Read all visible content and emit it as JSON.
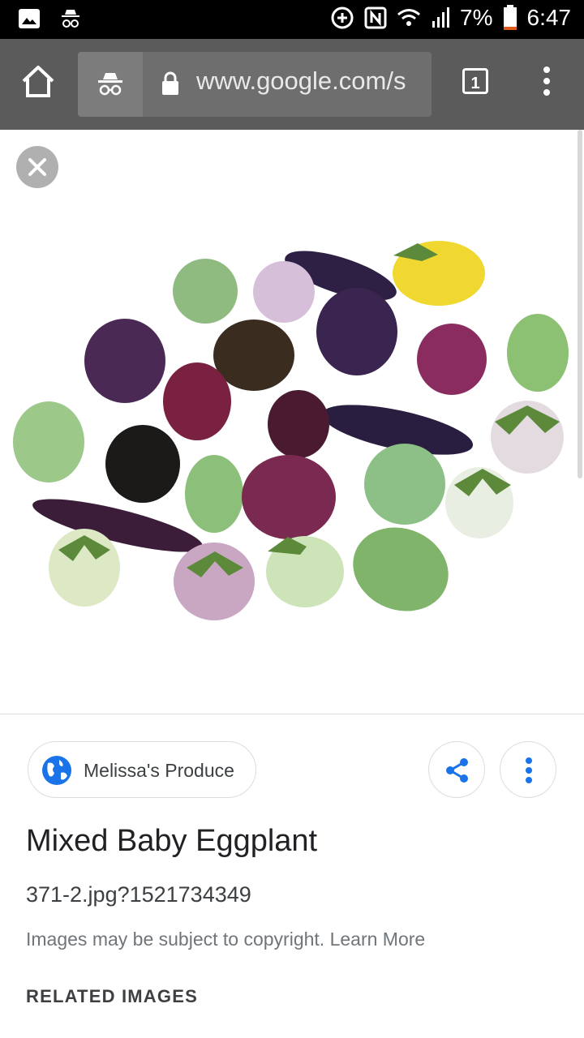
{
  "status_bar": {
    "battery": "7%",
    "time": "6:47",
    "icons": [
      "gallery-icon",
      "incognito-icon",
      "data-saver-icon",
      "nfc-icon",
      "wifi-icon",
      "signal-icon",
      "battery-icon"
    ]
  },
  "browser": {
    "url": "www.google.com/s",
    "tab_count": "1",
    "icons": [
      "home-icon",
      "incognito-icon",
      "lock-icon",
      "more-vert-icon"
    ]
  },
  "viewer": {
    "close_icon": "close-icon",
    "image_subject": "Mixed baby eggplants on white background",
    "source": {
      "label": "Melissa's Produce",
      "icon": "globe-icon"
    },
    "actions": [
      "share-icon",
      "more-vert-icon"
    ],
    "title": "Mixed Baby Eggplant",
    "filename": "371-2.jpg?1521734349",
    "copyright": "Images may be subject to copyright. Learn More",
    "related_heading": "RELATED IMAGES"
  },
  "colors": {
    "statusbar": "#000000",
    "toolbar": "#5b5b5b",
    "accent_blue": "#1a73e8"
  }
}
